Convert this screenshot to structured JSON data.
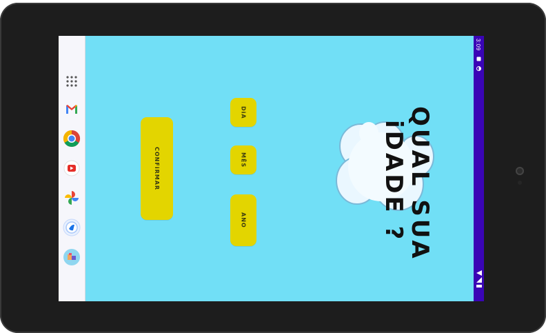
{
  "status": {
    "time": "3:09"
  },
  "taskbar": {
    "items": [
      {
        "name": "app-drawer-icon"
      },
      {
        "name": "gmail-icon"
      },
      {
        "name": "chrome-icon"
      },
      {
        "name": "youtube-icon"
      },
      {
        "name": "photos-icon"
      },
      {
        "name": "app-icon"
      },
      {
        "name": "game-app-icon"
      }
    ]
  },
  "app": {
    "title_line1": "QUAL SUA",
    "title_line2": "iDADE ?",
    "buttons": {
      "day": "DiA",
      "month": "MÊS",
      "year": "ANO",
      "confirm": "CONFiRMAR"
    }
  },
  "colors": {
    "background": "#71dff6",
    "button": "#e3d500",
    "statusbar": "#3a05b5",
    "cloud": "#eaf7ff"
  }
}
